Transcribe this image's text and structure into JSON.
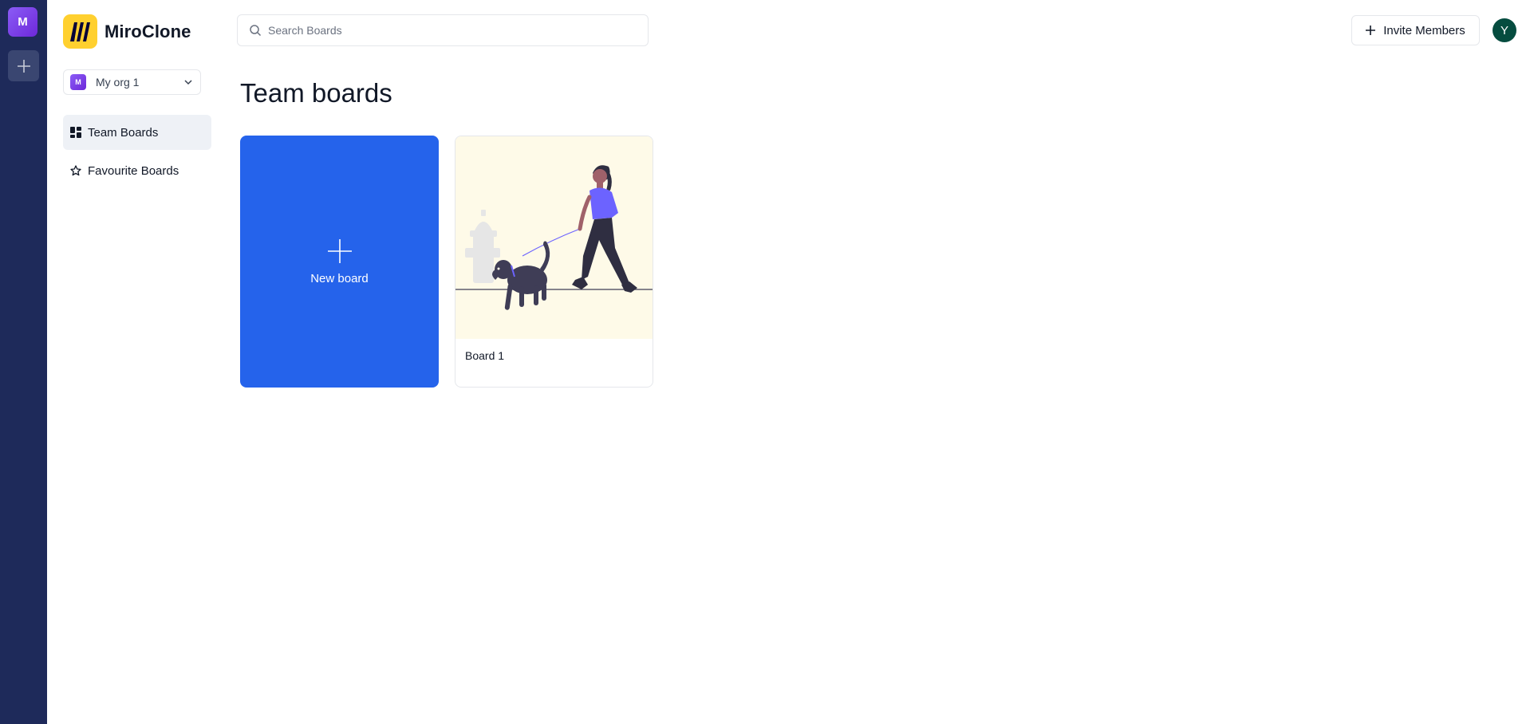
{
  "rail": {
    "org_initial": "M"
  },
  "sidebar": {
    "app_name": "MiroClone",
    "org_select": {
      "avatar_initial": "M",
      "selected": "My org 1"
    },
    "nav": [
      {
        "label": "Team Boards",
        "icon": "dashboard-icon",
        "active": true
      },
      {
        "label": "Favourite Boards",
        "icon": "star-icon",
        "active": false
      }
    ]
  },
  "header": {
    "search": {
      "placeholder": "Search Boards",
      "value": ""
    },
    "invite_label": "Invite Members",
    "user_initial": "Y"
  },
  "main": {
    "title": "Team boards",
    "new_board_label": "New board",
    "boards": [
      {
        "title": "Board 1",
        "thumbnail": "woman-walking-dog-illustration"
      }
    ]
  },
  "colors": {
    "rail_bg": "#1e2a5a",
    "brand_yellow": "#ffd02f",
    "primary_blue": "#2563eb",
    "org_purple": "#7c3aed",
    "avatar_green": "#054c3f",
    "thumb_bg": "#fefae8"
  }
}
